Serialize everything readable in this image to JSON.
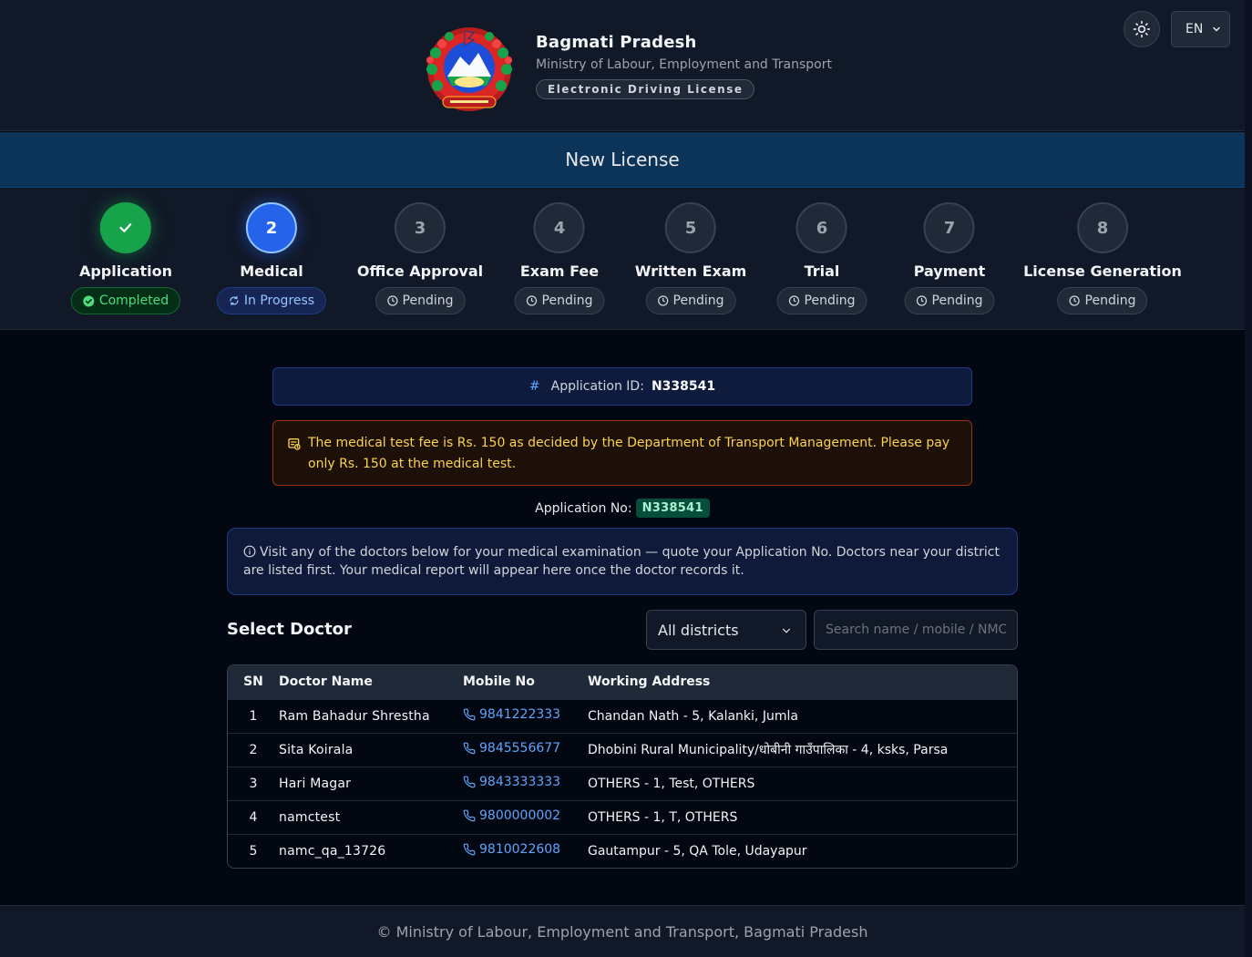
{
  "header": {
    "title": "Bagmati Pradesh",
    "subtitle": "Ministry of Labour, Employment and Transport",
    "badge": "Electronic Driving License",
    "emblem_icon": "nepal-emblem",
    "theme_icon": "sun-icon",
    "language": "EN"
  },
  "banner": {
    "title": "New License"
  },
  "steps": [
    {
      "number": "",
      "label": "Application",
      "status": "Completed",
      "state": "done"
    },
    {
      "number": "2",
      "label": "Medical",
      "status": "In Progress",
      "state": "active"
    },
    {
      "number": "3",
      "label": "Office Approval",
      "status": "Pending",
      "state": "pending"
    },
    {
      "number": "4",
      "label": "Exam Fee",
      "status": "Pending",
      "state": "pending"
    },
    {
      "number": "5",
      "label": "Written Exam",
      "status": "Pending",
      "state": "pending"
    },
    {
      "number": "6",
      "label": "Trial",
      "status": "Pending",
      "state": "pending"
    },
    {
      "number": "7",
      "label": "Payment",
      "status": "Pending",
      "state": "pending"
    },
    {
      "number": "8",
      "label": "License Generation",
      "status": "Pending",
      "state": "pending"
    }
  ],
  "application": {
    "id_label": "Application ID:",
    "id_value": "N338541",
    "fee_notice": "The medical test fee is Rs. 150 as decided by the Department of Transport Management. Please pay only Rs. 150 at the medical test.",
    "no_label": "Application No:",
    "no_value": "N338541",
    "info": "Visit any of the doctors below for your medical examination — quote your Application No. Doctors near your district are listed first. Your medical report will appear here once the doctor records it."
  },
  "doctors": {
    "title": "Select Doctor",
    "district_filter": "All districts",
    "search_placeholder": "Search name / mobile / NMC",
    "columns": [
      "SN",
      "Doctor Name",
      "Mobile No",
      "Working Address"
    ],
    "rows": [
      {
        "sn": "1",
        "name": "Ram Bahadur Shrestha",
        "mobile": "9841222333",
        "address": "Chandan Nath - 5, Kalanki, Jumla"
      },
      {
        "sn": "2",
        "name": "Sita Koirala",
        "mobile": "9845556677",
        "address": "Dhobini Rural Municipality/धोबीनी गाउँपालिका - 4, ksks, Parsa"
      },
      {
        "sn": "3",
        "name": "Hari Magar",
        "mobile": "9843333333",
        "address": "OTHERS - 1, Test, OTHERS"
      },
      {
        "sn": "4",
        "name": "namctest",
        "mobile": "9800000002",
        "address": "OTHERS - 1, T, OTHERS"
      },
      {
        "sn": "5",
        "name": "namc_qa_13726",
        "mobile": "9810022608",
        "address": "Gautampur - 5, QA Tole, Udayapur"
      }
    ]
  },
  "footer": {
    "text": "© Ministry of Labour, Employment and Transport, Bagmati Pradesh"
  },
  "colors": {
    "accent": "#2563eb",
    "success": "#16a34a",
    "warning_text": "#fcd34d",
    "background": "#030712"
  }
}
